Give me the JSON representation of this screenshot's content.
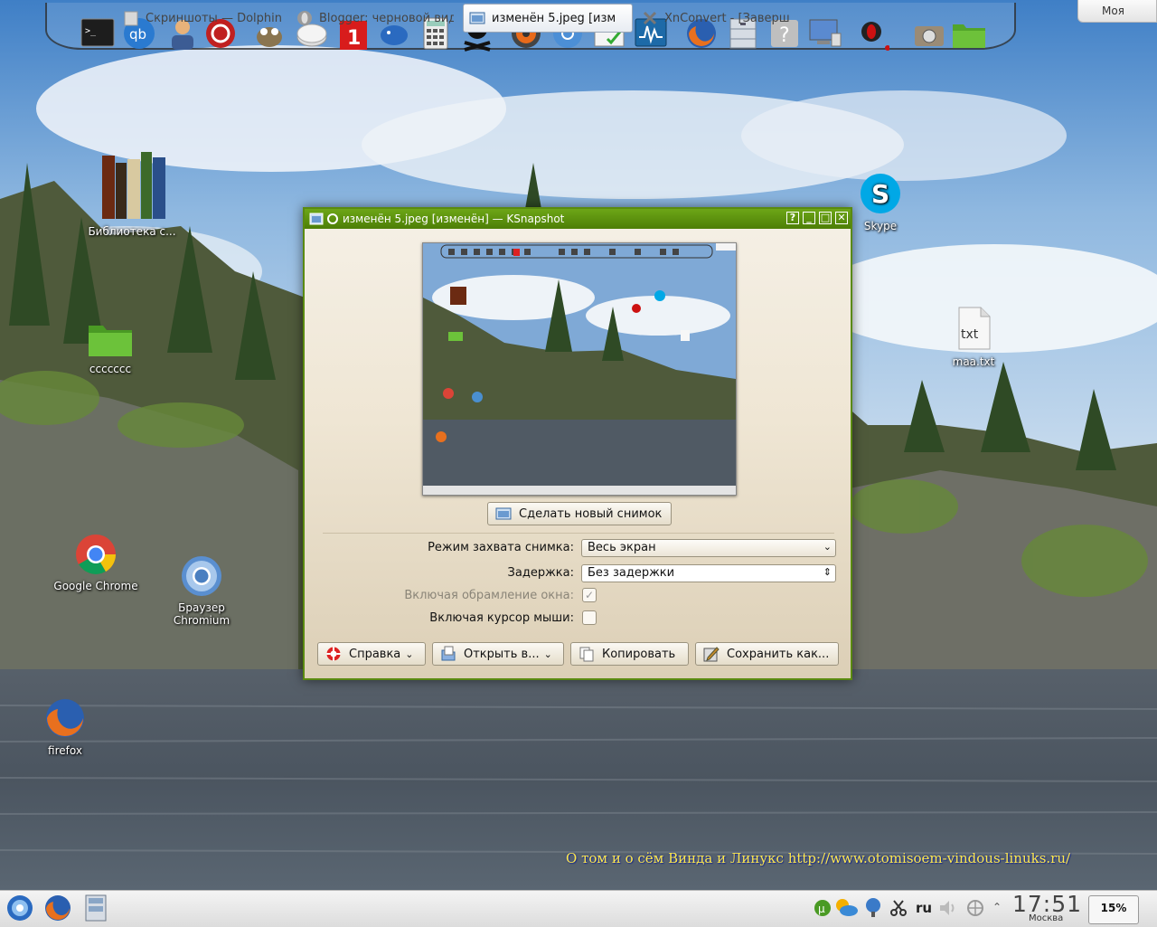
{
  "wallpaper": {
    "watermark": "О том и о сём Винда и Линукс http://www.otomisoem-vindous-linuks.ru/"
  },
  "top_dock": {
    "icons": [
      "terminal-icon",
      "qbittorrent-icon",
      "contacts-icon",
      "shutdown-app-icon",
      "gimp-icon",
      "disk-icon",
      "pdf-free-icon",
      "blowfish-icon",
      "calculator-icon",
      "pirate-skull-icon",
      "disc-burner-icon",
      "chromium-icon",
      "checklist-icon",
      "system-monitor-icon",
      "firefox-icon",
      "filing-cabinet-icon",
      "help-icon",
      "network-monitor-icon",
      "opera-icon",
      "camera-icon",
      "folder-icon"
    ],
    "corner_widget_label": "Моя"
  },
  "desktop": {
    "icons": [
      {
        "name": "calibre-library",
        "label": "Библиотека с..."
      },
      {
        "name": "folder-ccccccc",
        "label": "ccccccc"
      },
      {
        "name": "google-chrome",
        "label": "Google Chrome"
      },
      {
        "name": "chromium-browser",
        "label_line1": "Браузер",
        "label_line2": "Chromium"
      },
      {
        "name": "firefox",
        "label": "firefox"
      },
      {
        "name": "skype",
        "label": "Skype"
      },
      {
        "name": "maa-txt",
        "label": "maa.txt",
        "glyph": "txt"
      }
    ]
  },
  "ksnapshot": {
    "title": "изменён 5.jpeg [изменён] — KSnapshot",
    "new_snapshot_button": "Сделать новый снимок",
    "capture_mode_label": "Режим захвата снимка:",
    "capture_mode_value": "Весь экран",
    "delay_label": "Задержка:",
    "delay_value": "Без задержки",
    "include_decorations_label": "Включая обрамление окна:",
    "include_decorations_checked": true,
    "include_cursor_label": "Включая курсор мыши:",
    "include_cursor_checked": false,
    "help_button": "Справка",
    "open_with_button": "Открыть в...",
    "copy_button": "Копировать",
    "save_as_button": "Сохранить как..."
  },
  "taskbar": {
    "tasks": [
      {
        "label": "Скриншоты — Dolphin",
        "active": false
      },
      {
        "label": "Blogger: черновой вид",
        "active": false
      },
      {
        "label": "изменён 5.jpeg [изм",
        "active": true
      },
      {
        "label": "XnConvert - [Заверш",
        "active": false
      }
    ],
    "keyboard_layout": "ru",
    "clock_time": "17:51",
    "clock_city": "Москва",
    "battery": "15%"
  },
  "colors": {
    "titlebar": "#5a8a10",
    "window_bg": "#efe6d4",
    "watermark": "#ffe94a"
  }
}
